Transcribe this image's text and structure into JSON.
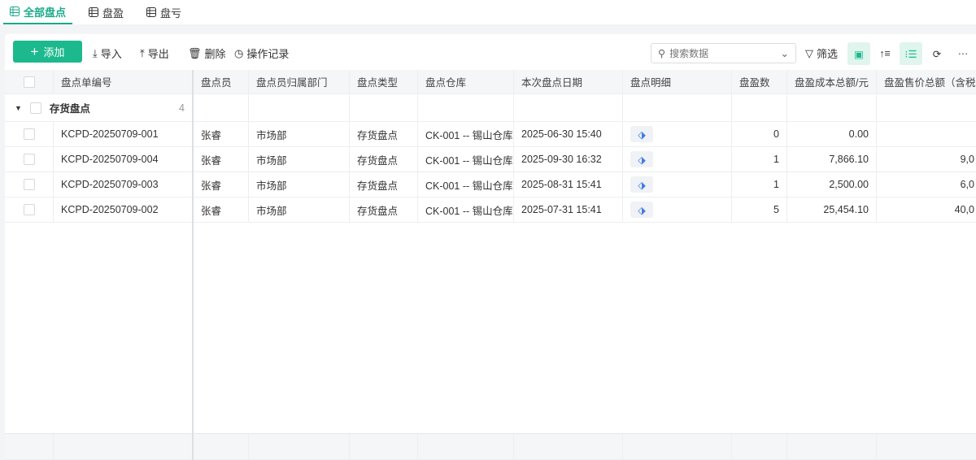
{
  "tabs": [
    {
      "label": "全部盘点"
    },
    {
      "label": "盘盈"
    },
    {
      "label": "盘亏"
    }
  ],
  "toolbar": {
    "add": "添加",
    "import": "导入",
    "export": "导出",
    "delete": "删除",
    "log": "操作记录",
    "search_placeholder": "搜索数据",
    "filter": "筛选"
  },
  "columns": [
    "盘点单编号",
    "盘点员",
    "盘点员归属部门",
    "盘点类型",
    "盘点仓库",
    "本次盘点日期",
    "盘点明细",
    "盘盈数",
    "盘盈成本总额/元",
    "盘盈售价总额（含税）"
  ],
  "group": {
    "label": "存货盘点",
    "count": "4"
  },
  "rows": [
    {
      "id": "KCPD-20250709-001",
      "staff": "张睿",
      "dept": "市场部",
      "type": "存货盘点",
      "wh": "CK-001 -- 锡山仓库",
      "date": "2025-06-30 15:40",
      "qty": "0",
      "cost": "0.00",
      "price": ""
    },
    {
      "id": "KCPD-20250709-004",
      "staff": "张睿",
      "dept": "市场部",
      "type": "存货盘点",
      "wh": "CK-001 -- 锡山仓库",
      "date": "2025-09-30 16:32",
      "qty": "1",
      "cost": "7,866.10",
      "price": "9,0"
    },
    {
      "id": "KCPD-20250709-003",
      "staff": "张睿",
      "dept": "市场部",
      "type": "存货盘点",
      "wh": "CK-001 -- 锡山仓库",
      "date": "2025-08-31 15:41",
      "qty": "1",
      "cost": "2,500.00",
      "price": "6,0"
    },
    {
      "id": "KCPD-20250709-002",
      "staff": "张睿",
      "dept": "市场部",
      "type": "存货盘点",
      "wh": "CK-001 -- 锡山仓库",
      "date": "2025-07-31 15:41",
      "qty": "5",
      "cost": "25,454.10",
      "price": "40,0"
    }
  ],
  "colors": {
    "accent": "#1db98e"
  }
}
